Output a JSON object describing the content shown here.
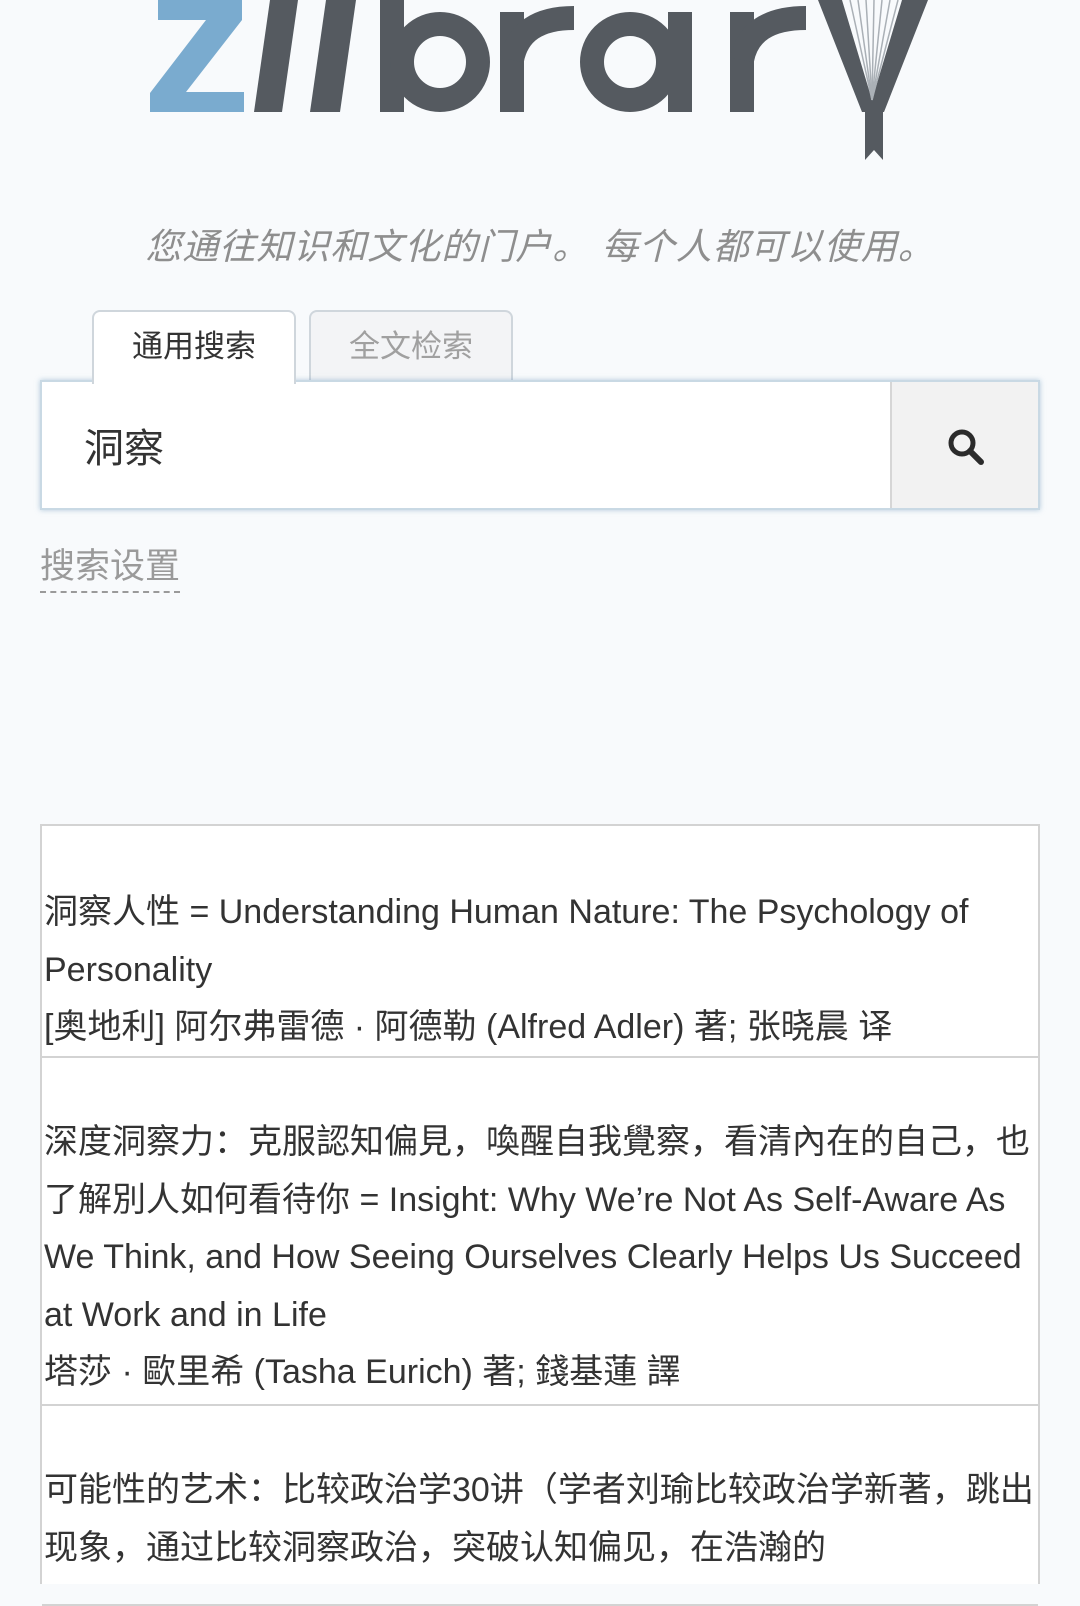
{
  "logo": {
    "text": "zlibrary",
    "colors": {
      "z": "#7aabcf",
      "letters": "#555a60",
      "bookmark": "#555a60"
    }
  },
  "tagline": "您通往知识和文化的门户。 每个人都可以使用。",
  "search": {
    "tabs": [
      {
        "label": "通用搜索",
        "active": true
      },
      {
        "label": "全文检索",
        "active": false
      }
    ],
    "value": "洞察",
    "placeholder": "",
    "button_icon": "search-icon"
  },
  "settings_link": "搜索设置",
  "results": [
    {
      "title": "洞察人性 = Understanding Human Nature: The Psychology of Personality",
      "author": "[奥地利] 阿尔弗雷德 · 阿德勒 (Alfred Adler) 著; 张晓晨 译"
    },
    {
      "title": "深度洞察力：克服認知偏見，喚醒自我覺察，看清內在的自己，也了解別人如何看待你 = Insight: Why We’re Not As Self-Aware As We Think, and How Seeing Ourselves Clearly Helps Us Succeed at Work and in Life",
      "author": "塔莎 · 歐里希 (Tasha Eurich) 著; 錢基蓮 譯"
    },
    {
      "title": "可能性的艺术：比较政治学30讲（学者刘瑜比较政治学新著，跳出现象，通过比较洞察政治，突破认知偏见，在浩瀚的",
      "author": ""
    }
  ],
  "colors": {
    "background": "#f8fafc",
    "accent": "#7aabcf",
    "border": "#d3d3d3"
  }
}
